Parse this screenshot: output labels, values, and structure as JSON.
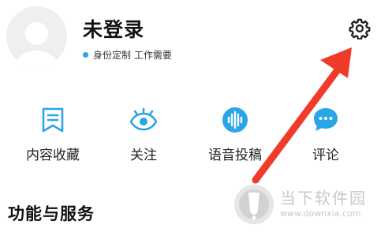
{
  "profile": {
    "name": "未登录",
    "identity_text": "身份定制 工作需要",
    "dot_color": "#2aa5e8"
  },
  "header": {
    "settings_icon": "gear-icon"
  },
  "actions": [
    {
      "label": "内容收藏",
      "icon": "bookmark-icon"
    },
    {
      "label": "关注",
      "icon": "eye-icon"
    },
    {
      "label": "语音投稿",
      "icon": "voice-icon"
    },
    {
      "label": "评论",
      "icon": "comment-icon"
    }
  ],
  "section": {
    "title": "功能与服务"
  },
  "watermark": {
    "brand": "当下软件园",
    "url": "www.downxia.com"
  },
  "colors": {
    "accent": "#2aa5e8",
    "annotation_arrow": "#f03a2a"
  }
}
